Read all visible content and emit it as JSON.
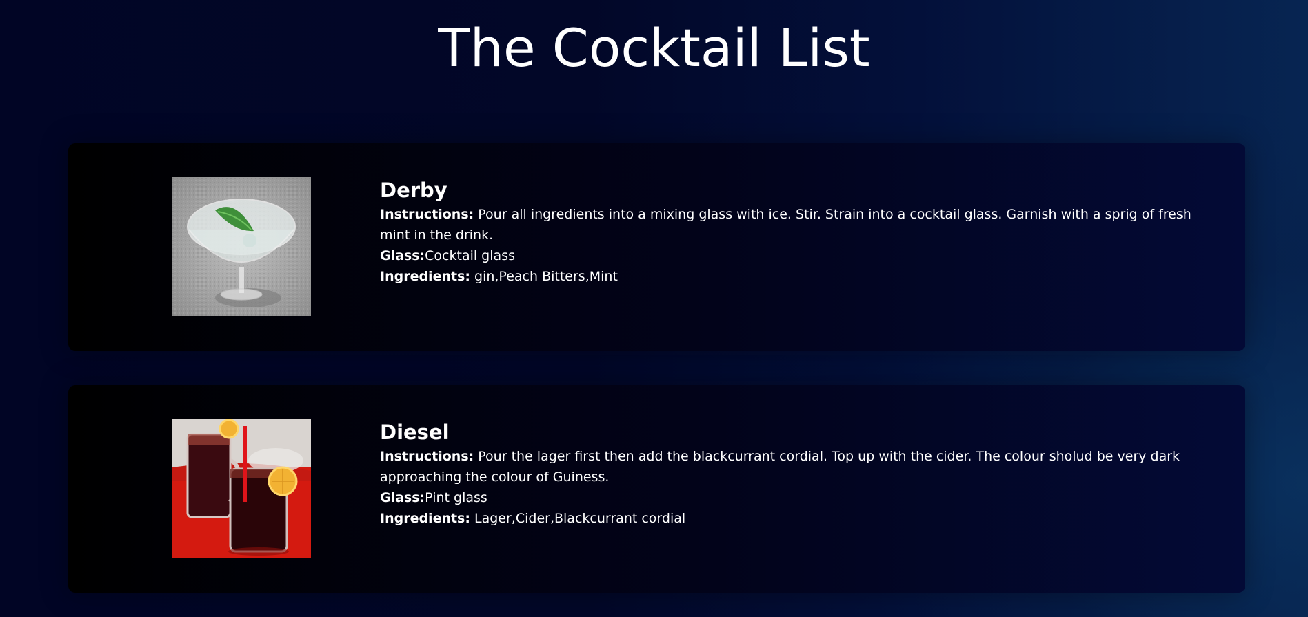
{
  "page": {
    "title": "The Cocktail List"
  },
  "labels": {
    "instructions": "Instructions:",
    "glass": "Glass:",
    "ingredients": "Ingredients:"
  },
  "cocktails": [
    {
      "name": "Derby",
      "instructions": "Pour all ingredients into a mixing glass with ice. Stir. Strain into a cocktail glass. Garnish with a sprig of fresh mint in the drink.",
      "glass": "Cocktail glass",
      "ingredients": "gin,Peach Bitters,Mint",
      "image": "cocktail-glass-with-mint-photo"
    },
    {
      "name": "Diesel",
      "instructions": "Pour the lager first then add the blackcurrant cordial. Top up with the cider. The colour sholud be very dark approaching the colour of Guiness.",
      "glass": "Pint glass",
      "ingredients": "Lager,Cider,Blackcurrant cordial",
      "image": "dark-drinks-on-red-table-photo"
    }
  ],
  "colors": {
    "background": "#020728",
    "card": "#000000",
    "text": "#ffffff"
  }
}
